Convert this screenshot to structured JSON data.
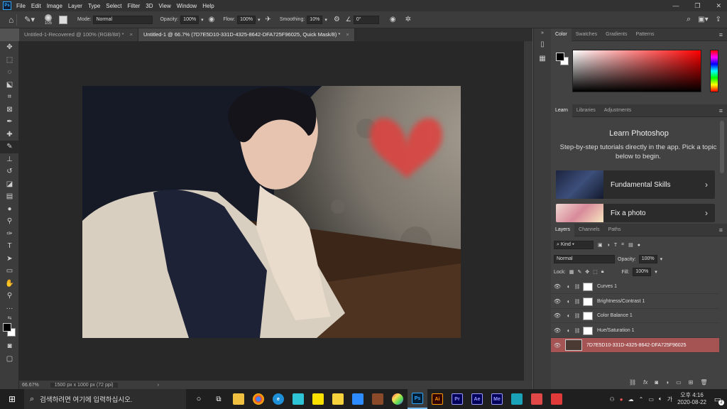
{
  "menubar": {
    "logo": "Ps",
    "items": [
      "File",
      "Edit",
      "Image",
      "Layer",
      "Type",
      "Select",
      "Filter",
      "3D",
      "View",
      "Window",
      "Help"
    ],
    "win_min": "—",
    "win_max": "❐",
    "win_close": "✕"
  },
  "options": {
    "brush_size": "105",
    "mode_label": "Mode:",
    "mode_value": "Normal",
    "opacity_label": "Opacity:",
    "opacity_value": "100%",
    "flow_label": "Flow:",
    "flow_value": "100%",
    "smoothing_label": "Smoothing:",
    "smoothing_value": "10%",
    "angle_value": "0°"
  },
  "tabs": [
    {
      "label": "Untitled-1-Recovered @ 100% (RGB/8#) *",
      "close": "×"
    },
    {
      "label": "Untitled-1 @ 66.7% (7D7E5D10-331D-4325-8642-DFA725F96025, Quick Mask/8) *",
      "close": "×"
    }
  ],
  "status": {
    "zoom": "66.67%",
    "doc_info": "1500 px x 1000 px (72 ppi)",
    "arrow": "›"
  },
  "color_panel": {
    "tabs": [
      "Color",
      "Swatches",
      "Gradients",
      "Patterns"
    ]
  },
  "learn_panel": {
    "tabs": [
      "Learn",
      "Libraries",
      "Adjustments"
    ],
    "title": "Learn Photoshop",
    "description": "Step-by-step tutorials directly in the app. Pick a topic below to begin.",
    "cards": [
      {
        "label": "Fundamental Skills"
      },
      {
        "label": "Fix a photo"
      }
    ],
    "chevron": "›"
  },
  "layers_panel": {
    "tabs": [
      "Layers",
      "Channels",
      "Paths"
    ],
    "filter_label": "Kind",
    "blend_mode": "Normal",
    "opacity_label": "Opacity:",
    "opacity_value": "100%",
    "lock_label": "Lock:",
    "fill_label": "Fill:",
    "fill_value": "100%",
    "layers": [
      {
        "name": "Curves 1"
      },
      {
        "name": "Brightness/Contrast 1"
      },
      {
        "name": "Color Balance 1"
      },
      {
        "name": "Hue/Saturation 1"
      },
      {
        "name": "7D7E5D10-331D-4325-8642-DFA725F96025"
      }
    ],
    "footer_icons": [
      "link-icon",
      "fx-icon",
      "mask-icon",
      "adjustment-icon",
      "folder-icon",
      "new-layer-icon",
      "trash-icon"
    ],
    "fx_label": "fx"
  },
  "taskbar": {
    "search_placeholder": "검색하려면 여기에 입력하십시오.",
    "time": "오후 4:16",
    "date": "2020-08-22",
    "notification_count": "2",
    "apps": [
      {
        "label": "Ps",
        "bg": "#001e36",
        "fg": "#31a8ff"
      },
      {
        "label": "Ai",
        "bg": "#330000",
        "fg": "#ff9a00"
      },
      {
        "label": "Pr",
        "bg": "#00005b",
        "fg": "#9999ff"
      },
      {
        "label": "Ae",
        "bg": "#00005b",
        "fg": "#9999ff"
      },
      {
        "label": "Me",
        "bg": "#00005b",
        "fg": "#9999ff"
      }
    ]
  },
  "colors": {
    "accent": "#31a8ff",
    "selected_layer": "#a55353",
    "heart": "#e0413d"
  }
}
